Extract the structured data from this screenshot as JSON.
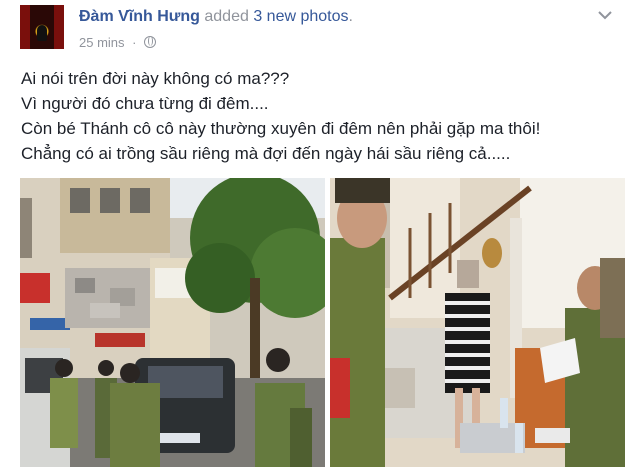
{
  "post": {
    "author": "Đàm Vĩnh Hưng",
    "action_text": "added",
    "photo_count_text": "3 new photos",
    "punct": ".",
    "time": "25 mins",
    "dot": "·",
    "audience_icon": "globe-icon",
    "menu_icon": "chevron-down-icon",
    "text_lines": [
      "Ai nói trên đời này không có ma???",
      "Vì người đó chưa từng đi đêm....",
      "Còn bé Thánh cô cô này thường xuyên đi đêm nên phải gặp ma thôi!",
      "Chẳng có ai trồng sầu riêng mà đợi đến ngày hái sầu riêng cả....."
    ]
  },
  "colors": {
    "link": "#365899",
    "meta": "#90949c",
    "text": "#1d2129"
  }
}
